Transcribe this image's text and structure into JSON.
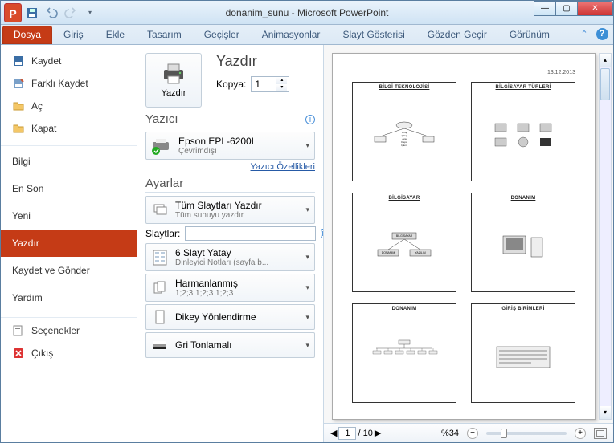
{
  "titlebar": {
    "title": "donanim_sunu - Microsoft PowerPoint",
    "appLetter": "P"
  },
  "tabs": {
    "file": "Dosya",
    "home": "Giriş",
    "insert": "Ekle",
    "design": "Tasarım",
    "transitions": "Geçişler",
    "animations": "Animasyonlar",
    "slideshow": "Slayt Gösterisi",
    "review": "Gözden Geçir",
    "view": "Görünüm"
  },
  "sidebar": {
    "save": "Kaydet",
    "saveAs": "Farklı Kaydet",
    "open": "Aç",
    "close": "Kapat",
    "info": "Bilgi",
    "recent": "En Son",
    "new": "Yeni",
    "print": "Yazdır",
    "saveSend": "Kaydet ve Gönder",
    "help": "Yardım",
    "options": "Seçenekler",
    "exit": "Çıkış"
  },
  "print": {
    "heading": "Yazdır",
    "button": "Yazdır",
    "copiesLabel": "Kopya:",
    "copiesValue": "1",
    "printerHeading": "Yazıcı",
    "printerName": "Epson EPL-6200L",
    "printerStatus": "Çevrimdışı",
    "printerProps": "Yazıcı Özellikleri",
    "settingsHeading": "Ayarlar",
    "rangeTitle": "Tüm Slaytları Yazdır",
    "rangeSub": "Tüm sunuyu yazdır",
    "slidesLabel": "Slaytlar:",
    "layoutTitle": "6 Slayt Yatay",
    "layoutSub": "Dinleyici Notları (sayfa b...",
    "collateTitle": "Harmanlanmış",
    "collateSub": "1;2;3   1;2;3   1;2;3",
    "orientTitle": "Dikey Yönlendirme",
    "colorTitle": "Gri Tonlamalı"
  },
  "preview": {
    "date": "13.12.2013",
    "thumbs": [
      "BİLGİ TEKNOLOJİSİ",
      "BİLGİSAYAR TÜRLERİ",
      "BİLGİSAYAR",
      "DONANIM",
      "DONANIM",
      "GİRİŞ BİRİMLERİ"
    ],
    "t1list": [
      "Giriş",
      "Çıkış",
      "Ana",
      "Depo",
      "İşlem"
    ],
    "t3boxes": {
      "top": "BİLGİSAYAR",
      "left": "DONANIM",
      "right": "YAZILIM"
    }
  },
  "status": {
    "page": "1",
    "pageTotal": "/ 10",
    "zoom": "%34"
  }
}
